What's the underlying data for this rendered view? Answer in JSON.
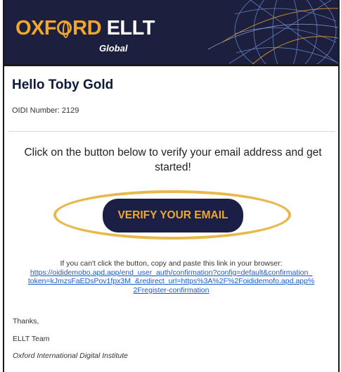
{
  "header": {
    "brand_word1_a": "OXF",
    "brand_word1_b": "RD",
    "brand_word2": "ELLT",
    "brand_sub": "Global",
    "bg_color": "#1c1f3d",
    "accent_color": "#f3a72a"
  },
  "greeting": "Hello Toby Gold",
  "oidi_number": "OIDI Number: 2129",
  "intro_text": "Click on the button below to verify your email address and get started!",
  "verify_button": {
    "label": "VERIFY YOUR EMAIL",
    "bg_color": "#1b1f45",
    "text_color": "#f3a72a"
  },
  "fallback": {
    "instruction": "If you can't click the button, copy and paste this link in your browser:",
    "link_lines": [
      "https://oididemobo.apd.app/end_user_auth/confirmation?config=default&confirmation_",
      "token=kJmzsFaEDsPov1fpx3M_&redirect_url=https%3A%2F%2Foididemofo.apd.app%",
      "2Fregister-confirmation"
    ]
  },
  "signoff": {
    "thanks": "Thanks,",
    "team": "ELLT Team",
    "org": "Oxford International Digital Institute"
  },
  "highlight_color": "#e8b84a"
}
